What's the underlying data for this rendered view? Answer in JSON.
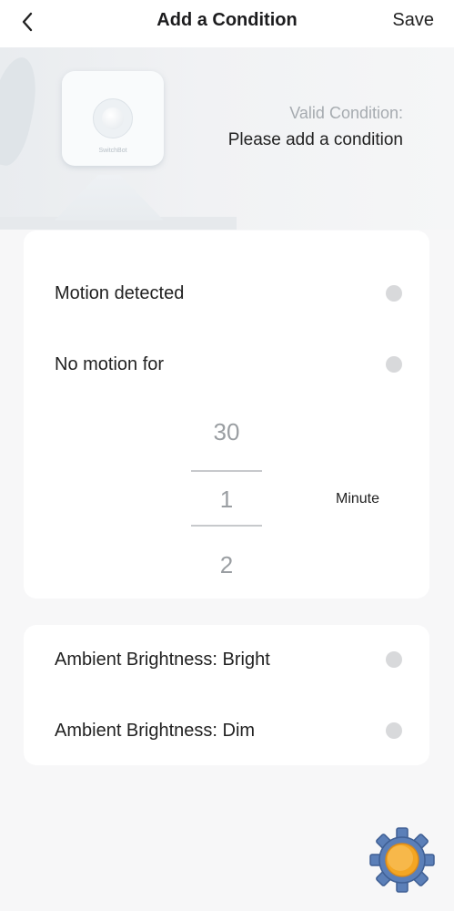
{
  "header": {
    "title": "Add a Condition",
    "save_label": "Save"
  },
  "hero": {
    "device_brand": "SwitchBot",
    "valid_label": "Valid Condition:",
    "valid_value": "Please add a condition"
  },
  "motion_options": [
    {
      "label": "Motion detected",
      "selected": false
    },
    {
      "label": "No motion for",
      "selected": false
    }
  ],
  "picker": {
    "prev": "30",
    "current": "1",
    "next": "2",
    "unit": "Minute"
  },
  "brightness_options": [
    {
      "label": "Ambient Brightness: Bright",
      "selected": false
    },
    {
      "label": "Ambient Brightness: Dim",
      "selected": false
    }
  ],
  "colors": {
    "accent_orange": "#f4a623",
    "gear_blue": "#5b7fb8",
    "radio_gray": "#d8d9db"
  }
}
